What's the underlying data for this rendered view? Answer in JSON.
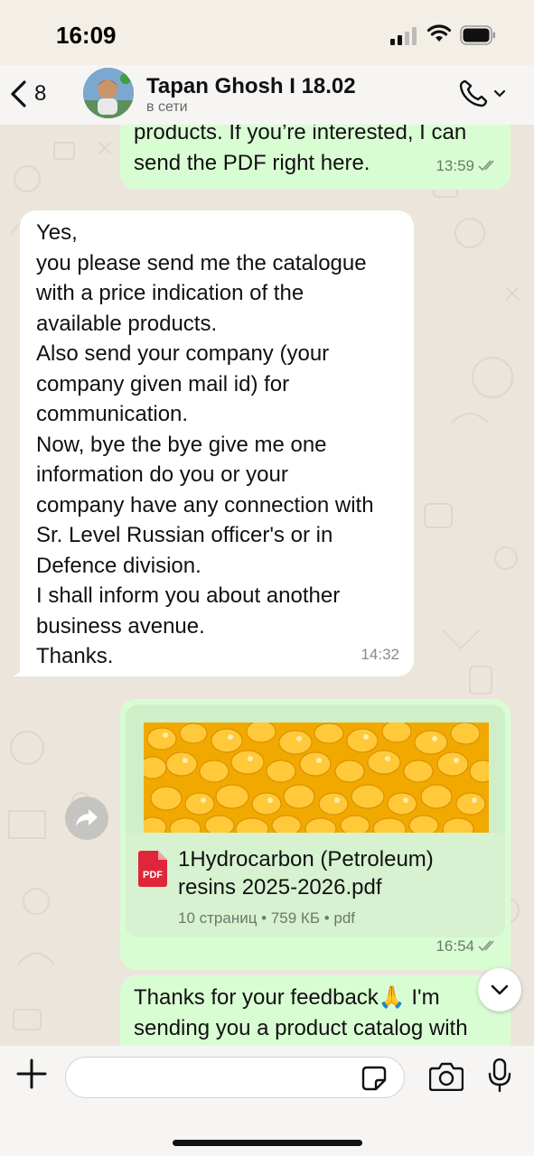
{
  "status_bar": {
    "time": "16:09"
  },
  "header": {
    "back_count": "8",
    "contact_name": "Tapan Ghosh I 18.02",
    "contact_status": "в сети"
  },
  "messages": [
    {
      "direction": "out",
      "text": "products. If you’re interested, I can\nsend the PDF right here.",
      "time": "13:59",
      "read": true
    },
    {
      "direction": "in",
      "text": "Yes,\nyou please send me the catalogue\nwith a price indication of the\navailable products.\nAlso send your company (your\ncompany given mail id) for\ncommunication.\nNow, bye the bye give me one\ninformation do you or your\ncompany have any connection with\nSr. Level Russian officer's or in\nDefence division.\nI shall inform you about another\nbusiness avenue.\nThanks.",
      "time": "14:32"
    },
    {
      "direction": "out",
      "attachment": {
        "type": "pdf",
        "icon_label": "PDF",
        "file_name": "1Hydrocarbon (Petroleum) resins 2025-2026.pdf",
        "details": "10 страниц • 759 КБ • pdf"
      },
      "time": "16:54",
      "read": true
    },
    {
      "direction": "out",
      "text": "Thanks for your feedback🙏 I'm\nsending you a product catalog with"
    }
  ],
  "input": {
    "placeholder": ""
  },
  "colors": {
    "outgoing_bubble": "#d9fdd3",
    "incoming_bubble": "#ffffff",
    "read_ticks": "#53bdeb",
    "pdf_icon": "#e0263b"
  }
}
